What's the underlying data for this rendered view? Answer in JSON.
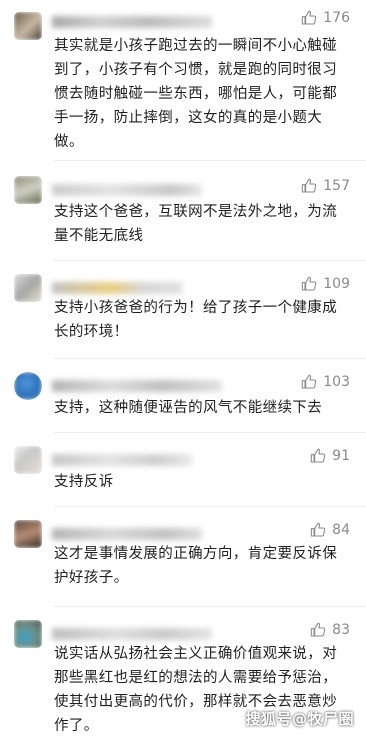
{
  "comments": [
    {
      "likes": "176",
      "text": "其实就是小孩子跑过去的一瞬间不小心触碰到了，小孩子有个习惯，就是跑的同时很习惯去随时触碰一些东西，哪怕是人，可能都手一扬，防止摔倒，这女的真的是小题大做。"
    },
    {
      "likes": "157",
      "text": "支持这个爸爸，互联网不是法外之地，为流量不能无底线"
    },
    {
      "likes": "109",
      "text": "支持小孩爸爸的行为！给了孩子一个健康成长的环境！"
    },
    {
      "likes": "103",
      "text": "支持，这种随便诬告的风气不能继续下去"
    },
    {
      "likes": "91",
      "text": "支持反诉"
    },
    {
      "likes": "84",
      "text": "这才是事情发展的正确方向，肯定要反诉保护好孩子。"
    },
    {
      "likes": "83",
      "text": "说实话从弘扬社会主义正确价值观来说，对那些黑红也是红的想法的人需要给予惩治，使其付出更高的代价，那样就不会去恶意炒作了。"
    }
  ],
  "watermark": "搜狐号@牧尸圈",
  "colors": {
    "text": "#1f1f1f",
    "muted": "#8a8a8a",
    "divider": "#ececec"
  },
  "icons": {
    "like": "thumbs-up-icon"
  }
}
